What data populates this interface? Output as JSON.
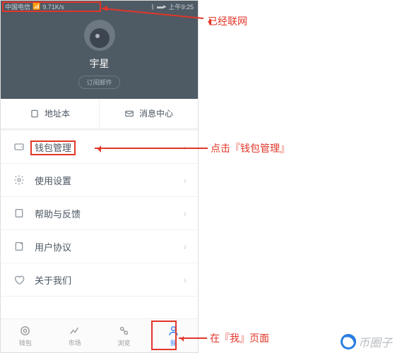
{
  "status_bar": {
    "carrier": "中国电信",
    "net_speed": "9.71K/s",
    "time": "上午9:25"
  },
  "profile": {
    "name": "宇星",
    "subscribe_label": "订阅邮件"
  },
  "quick": {
    "address_book": "地址本",
    "message_center": "消息中心"
  },
  "menu": {
    "wallet_mgmt": "钱包管理",
    "usage_settings": "使用设置",
    "help_feedback": "帮助与反馈",
    "user_agreement": "用户协议",
    "about_us": "关于我们"
  },
  "tabs": {
    "wallet": "钱包",
    "market": "市场",
    "browse": "浏览",
    "me": "我"
  },
  "annotations": {
    "networked": "已经联网",
    "click_wallet": "点击『钱包管理』",
    "on_me_page": "在『我』页面"
  },
  "watermark": "币圈子"
}
